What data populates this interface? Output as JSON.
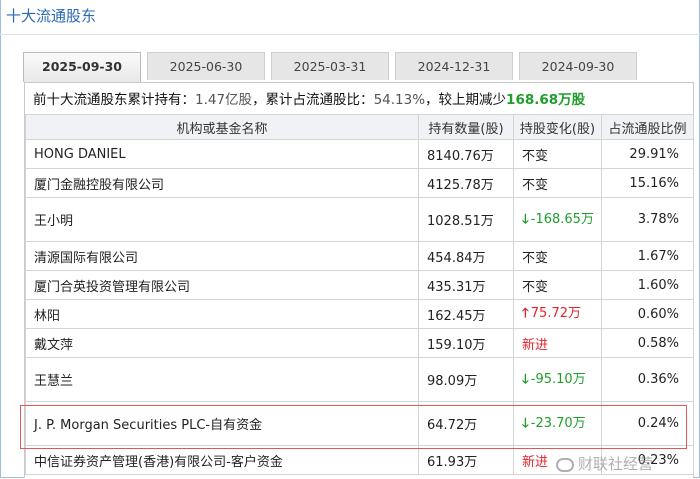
{
  "title": "十大流通股东",
  "tabs": [
    "2025-09-30",
    "2025-06-30",
    "2025-03-31",
    "2024-12-31",
    "2024-09-30"
  ],
  "active_tab": "2025-09-30",
  "summary": {
    "prefix": "前十大流通股东累计持有：",
    "holding": "1.47亿股",
    "ratio_label": "，累计占流通股比：",
    "ratio": "54.13%",
    "change_label": "，较上期减少",
    "change": "168.68万股"
  },
  "table": {
    "headers": [
      "机构或基金名称",
      "持有数量(股)",
      "持股变化(股)",
      "占流通股比例"
    ],
    "rows": [
      {
        "name": "HONG DANIEL",
        "qty": "8140.76万",
        "change": "不变",
        "pct": "29.91%"
      },
      {
        "name": "厦门金融控股有限公司",
        "qty": "4125.78万",
        "change": "不变",
        "pct": "15.16%"
      },
      {
        "name": "王小明",
        "qty": "1028.51万",
        "change": "-168.65万",
        "pct": "3.78%"
      },
      {
        "name": "清源国际有限公司",
        "qty": "454.84万",
        "change": "不变",
        "pct": "1.67%"
      },
      {
        "name": "厦门合英投资管理有限公司",
        "qty": "435.31万",
        "change": "不变",
        "pct": "1.60%"
      },
      {
        "name": "林阳",
        "qty": "162.45万",
        "change": "75.72万",
        "pct": "0.60%"
      },
      {
        "name": "戴文萍",
        "qty": "159.10万",
        "change": "新进",
        "pct": "0.58%"
      },
      {
        "name": "王慧兰",
        "qty": "98.09万",
        "change": "-95.10万",
        "pct": "0.36%"
      },
      {
        "name": "J. P. Morgan Securities PLC-自有资金",
        "qty": "64.72万",
        "change": "-23.70万",
        "pct": "0.24%"
      },
      {
        "name": "中信证券资产管理(香港)有限公司-客户资金",
        "qty": "61.93万",
        "change": "新进",
        "pct": "0.23%"
      }
    ]
  },
  "icons": {
    "up": "up-arrow-icon",
    "down": "down-arrow-icon"
  },
  "colors": {
    "accent": "#2a6ab5",
    "increase": "#e0262b",
    "decrease": "#1f9e2c",
    "highlight_border": "#e0585a"
  },
  "watermark": "财联社经营"
}
